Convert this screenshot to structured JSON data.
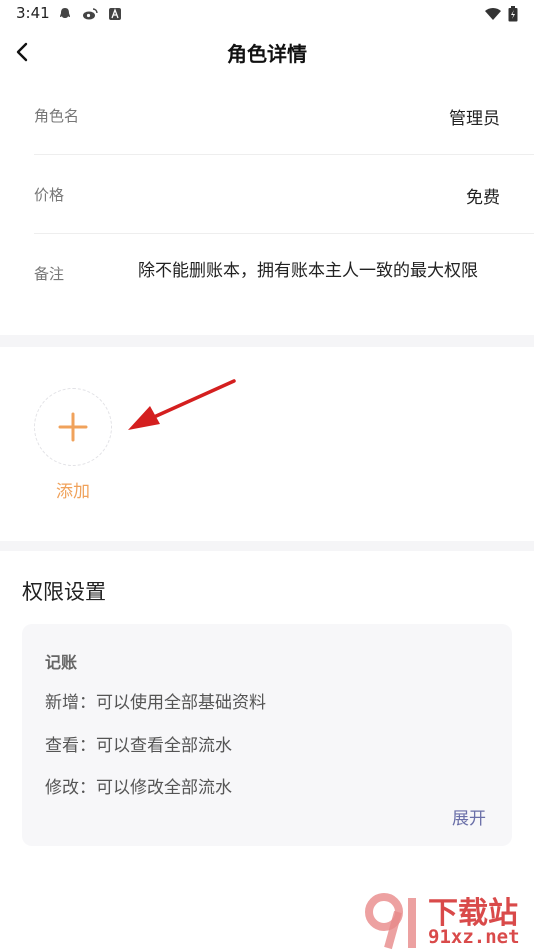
{
  "status_bar": {
    "time": "3:41"
  },
  "header": {
    "title": "角色详情"
  },
  "info": {
    "role_name_label": "角色名",
    "role_name_value": "管理员",
    "price_label": "价格",
    "price_value": "免费",
    "note_label": "备注",
    "note_value": "除不能删账本，拥有账本主人一致的最大权限"
  },
  "add": {
    "label": "添加"
  },
  "permissions": {
    "title": "权限设置",
    "category": "记账",
    "items": [
      "新增：可以使用全部基础资料",
      "查看：可以查看全部流水",
      "修改：可以修改全部流水"
    ],
    "expand_label": "展开"
  },
  "watermark": {
    "brand": "下载站",
    "url": "91xz.net"
  },
  "colors": {
    "accent_orange": "#f0a25b",
    "arrow_red": "#d41f1f",
    "link_purple": "#6a6fa8",
    "section_gap": "#f5f5f7"
  }
}
